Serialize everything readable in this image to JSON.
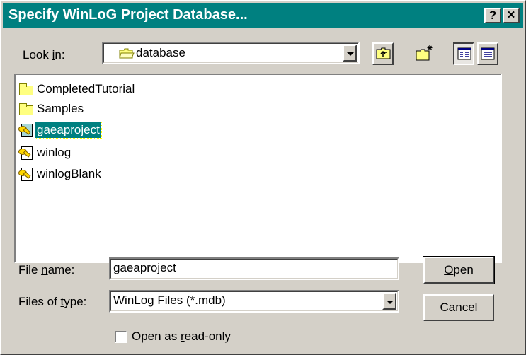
{
  "window": {
    "title": "Specify WinLoG Project Database...",
    "help_glyph": "?",
    "close_glyph": "×"
  },
  "look_in": {
    "label_pre": "Look ",
    "label_u": "i",
    "label_post": "n:",
    "value": "database"
  },
  "files": [
    {
      "name": "CompletedTutorial",
      "kind": "folder",
      "selected": false
    },
    {
      "name": "Samples",
      "kind": "folder",
      "selected": false
    },
    {
      "name": "gaeaproject",
      "kind": "mdb",
      "selected": true
    },
    {
      "name": "winlog",
      "kind": "mdb",
      "selected": false
    },
    {
      "name": "winlogBlank",
      "kind": "mdb",
      "selected": false
    }
  ],
  "file_name": {
    "label_pre": "File ",
    "label_u": "n",
    "label_post": "ame:",
    "value": "gaeaproject"
  },
  "file_type": {
    "label_pre": "Files of ",
    "label_u": "t",
    "label_post": "ype:",
    "value": "WinLog Files (*.mdb)"
  },
  "buttons": {
    "open_u": "O",
    "open_rest": "pen",
    "cancel": "Cancel"
  },
  "readonly": {
    "label_pre": "Open as ",
    "label_u": "r",
    "label_post": "ead-only",
    "checked": false
  },
  "colors": {
    "titlebar": "#008080",
    "dialog_face": "#d4d0c8",
    "selection": "#008080"
  }
}
